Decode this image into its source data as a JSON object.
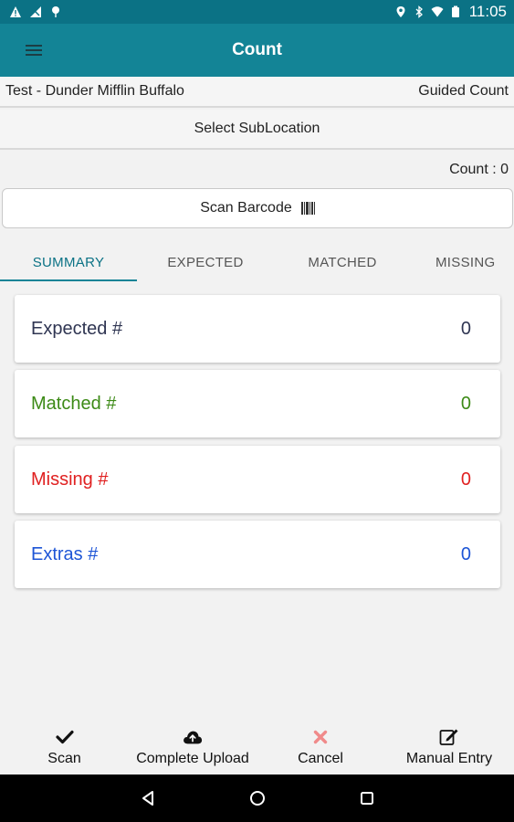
{
  "status_bar": {
    "time": "11:05"
  },
  "app_bar": {
    "title": "Count"
  },
  "info": {
    "location": "Test - Dunder Mifflin Buffalo",
    "mode": "Guided Count"
  },
  "sublocation": {
    "label": "Select SubLocation"
  },
  "count": {
    "label": "Count : 0"
  },
  "scan_barcode": {
    "label": "Scan Barcode"
  },
  "tabs": [
    {
      "label": "SUMMARY",
      "active": true
    },
    {
      "label": "EXPECTED",
      "active": false
    },
    {
      "label": "MATCHED",
      "active": false
    },
    {
      "label": "MISSING",
      "active": false
    }
  ],
  "cards": [
    {
      "label": "Expected #",
      "value": "0",
      "color": "#2f3552"
    },
    {
      "label": "Matched #",
      "value": "0",
      "color": "#3c8a16"
    },
    {
      "label": "Missing #",
      "value": "0",
      "color": "#e02020"
    },
    {
      "label": "Extras #",
      "value": "0",
      "color": "#1d55d6"
    }
  ],
  "actions": [
    {
      "label": "Scan",
      "icon": "check-icon"
    },
    {
      "label": "Complete Upload",
      "icon": "cloud-upload-icon"
    },
    {
      "label": "Cancel",
      "icon": "close-icon"
    },
    {
      "label": "Manual Entry",
      "icon": "edit-icon"
    }
  ],
  "colors": {
    "status_bar": "#0b7285",
    "app_bar": "#138496",
    "accent": "#138496"
  }
}
